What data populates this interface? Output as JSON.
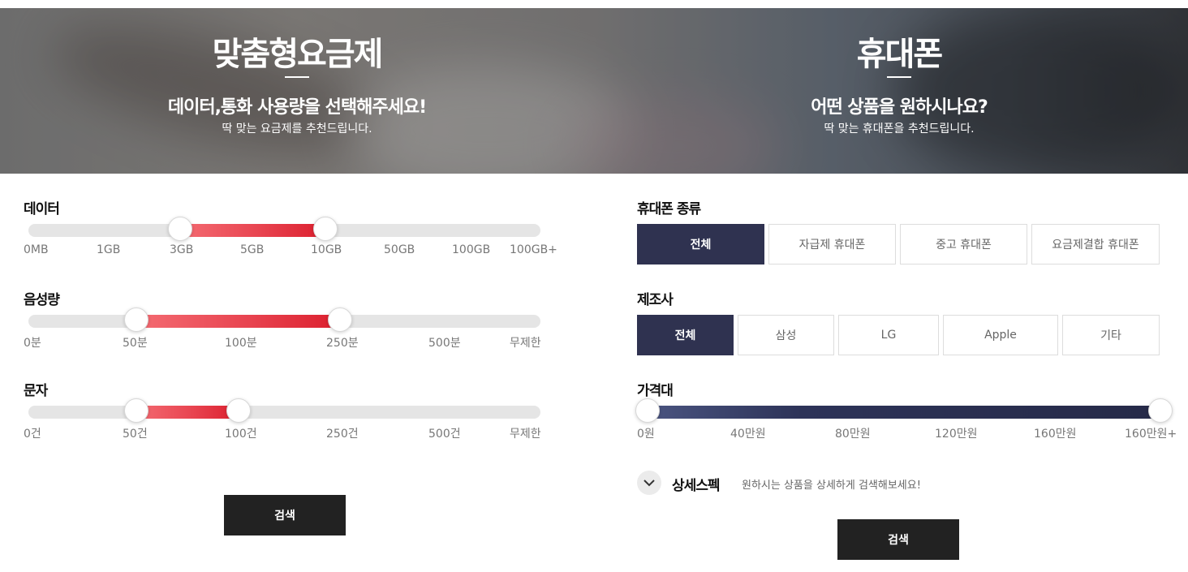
{
  "plan_banner": {
    "title": "맞춤형요금제",
    "subtitle": "데이터,통화 사용량을 선택해주세요!",
    "description": "딱 맞는 요금제를 추천드립니다."
  },
  "phone_banner": {
    "title": "휴대폰",
    "subtitle": "어떤 상품을 원하시나요?",
    "description": "딱 맞는 휴대폰을 추천드립니다."
  },
  "plan_filters": {
    "data": {
      "label": "데이터",
      "ticks": [
        "0MB",
        "1GB",
        "3GB",
        "5GB",
        "10GB",
        "50GB",
        "100GB",
        "100GB+"
      ],
      "selected_min": "3GB",
      "selected_max": "10GB"
    },
    "voice": {
      "label": "음성량",
      "ticks": [
        "0분",
        "50분",
        "100분",
        "250분",
        "500분",
        "무제한"
      ],
      "selected_min": "50분",
      "selected_max": "250분"
    },
    "sms": {
      "label": "문자",
      "ticks": [
        "0건",
        "50건",
        "100건",
        "250건",
        "500건",
        "무제한"
      ],
      "selected_min": "50건",
      "selected_max": "100건"
    },
    "search_label": "검색"
  },
  "phone_filters": {
    "type": {
      "label": "휴대폰 종류",
      "options": [
        "전체",
        "자급제 휴대폰",
        "중고 휴대폰",
        "요금제결합 휴대폰"
      ],
      "selected": "전체"
    },
    "maker": {
      "label": "제조사",
      "options": [
        "전체",
        "삼성",
        "LG",
        "Apple",
        "기타"
      ],
      "selected": "전체"
    },
    "price": {
      "label": "가격대",
      "ticks": [
        "0원",
        "40만원",
        "80만원",
        "120만원",
        "160만원",
        "160만원+"
      ],
      "selected_min": "0원",
      "selected_max": "160만원+"
    },
    "detail": {
      "title": "상세스펙",
      "description": "원하시는 상품을 상세하게 검색해보세요!",
      "icon": "chevron-down-icon"
    },
    "search_label": "검색"
  },
  "colors": {
    "accent_red": "#dc1f2e",
    "accent_navy": "#2f3250",
    "button_dark": "#222222"
  }
}
